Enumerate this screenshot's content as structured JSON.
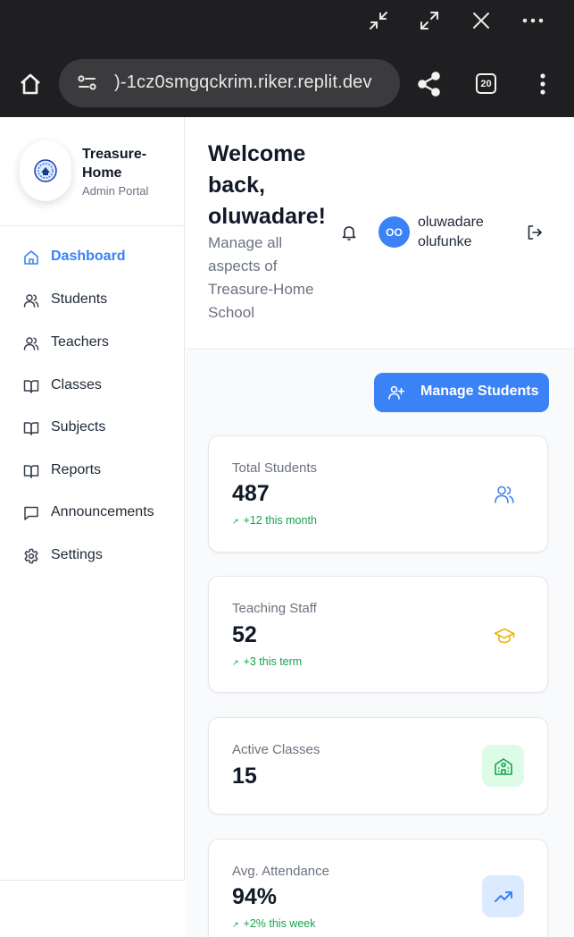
{
  "browser": {
    "url": ")-1cz0smgqckrim.riker.replit.dev",
    "tab_count": "20"
  },
  "brand": {
    "name": "Treasure-Home",
    "subtitle": "Admin Portal"
  },
  "sidebar": {
    "items": [
      {
        "label": "Dashboard",
        "icon": "home-icon",
        "active": true
      },
      {
        "label": "Students",
        "icon": "users-icon"
      },
      {
        "label": "Teachers",
        "icon": "users-icon"
      },
      {
        "label": "Classes",
        "icon": "book-open-icon"
      },
      {
        "label": "Subjects",
        "icon": "book-open-icon"
      },
      {
        "label": "Reports",
        "icon": "book-open-icon"
      },
      {
        "label": "Announcements",
        "icon": "message-square-icon"
      },
      {
        "label": "Settings",
        "icon": "gear-icon"
      }
    ]
  },
  "header": {
    "welcome": "Welcome back, oluwadare!",
    "subtitle": "Manage all aspects of Treasure-Home School",
    "user_initials": "OO",
    "user_name": "oluwadare olufunke"
  },
  "actions": {
    "manage_students": "Manage Students"
  },
  "stats": [
    {
      "label": "Total Students",
      "value": "487",
      "trend": "+12 this month",
      "icon": "users-icon",
      "color": "#3b82f6"
    },
    {
      "label": "Teaching Staff",
      "value": "52",
      "trend": "+3 this term",
      "icon": "graduation-cap-icon",
      "color": "#eab308"
    },
    {
      "label": "Active Classes",
      "value": "15",
      "icon": "school-icon",
      "color": "#16a34a"
    },
    {
      "label": "Avg. Attendance",
      "value": "94%",
      "trend": "+2% this week",
      "icon": "trending-up-icon",
      "color": "#3b82f6"
    }
  ],
  "colors": {
    "accent": "#3b82f6",
    "positive": "#16a34a",
    "chrome_bg": "#1f1f21"
  }
}
